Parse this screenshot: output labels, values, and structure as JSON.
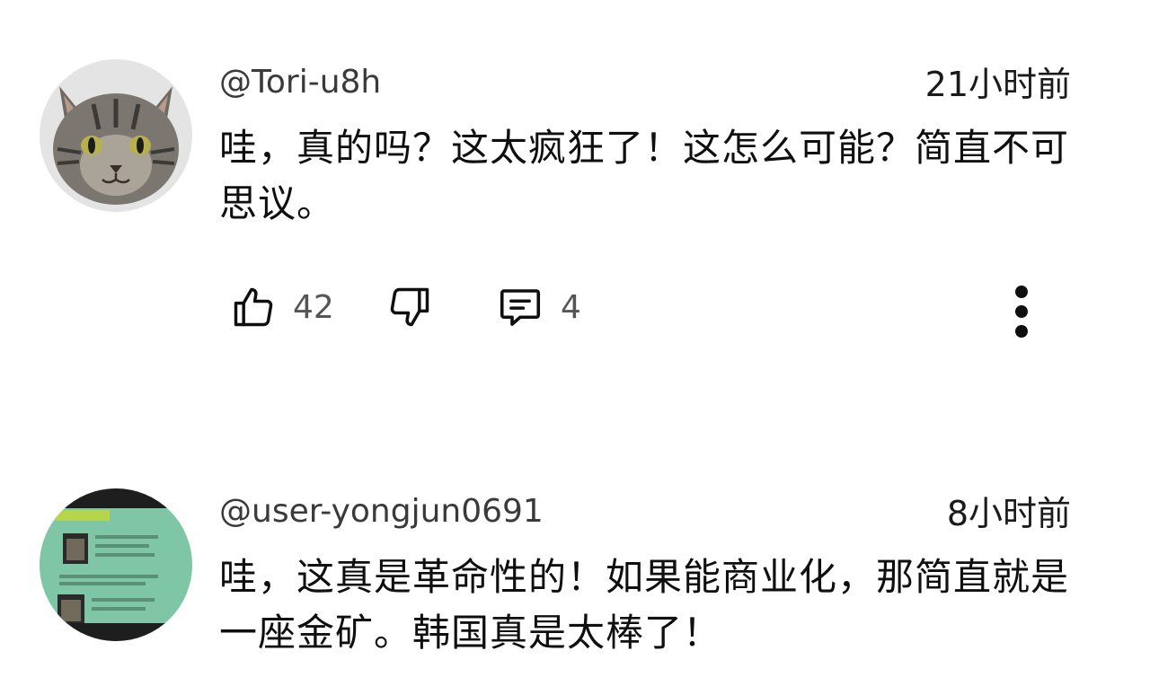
{
  "comments": [
    {
      "username": "@Tori-u8h",
      "timestamp": "21小时前",
      "text": "哇，真的吗？这太疯狂了！这怎么可能？简直不可思议。",
      "avatar_icon": "cat-avatar",
      "likes": "42",
      "replies": "4"
    },
    {
      "username": "@user-yongjun0691",
      "timestamp": "8小时前",
      "text": "哇，这真是革命性的！如果能商业化，那简直就是一座金矿。韩国真是太棒了！",
      "avatar_icon": "document-screenshot-avatar"
    }
  ],
  "icons": {
    "like": "thumbs-up-icon",
    "dislike": "thumbs-down-icon",
    "reply": "comment-icon",
    "more": "more-vertical-icon"
  },
  "colors": {
    "text": "#0f0f0f",
    "secondary": "#555555",
    "avatar2_bg": "#7fc6a6"
  }
}
